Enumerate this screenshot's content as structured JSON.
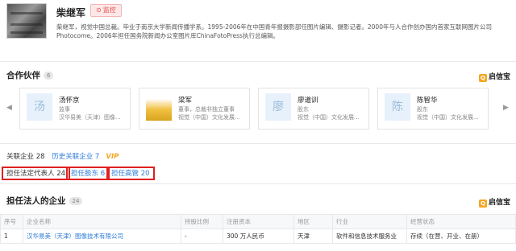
{
  "profile": {
    "name": "柴继军",
    "monitor_label": "监控",
    "bio": "柴继军，视觉中国总裁。毕业于南京大学新闻传播学系。1995-2006年在中国青年报摄影部任图片编辑、摄影记者。2000年与人合作创办国内首家互联网图片公司 Photocome。2006年担任国务院新闻办公室图片库ChinaFotoPress执行总编辑。"
  },
  "partners": {
    "title": "合作伙伴",
    "count": "6",
    "brand": "启信宝",
    "cards": [
      {
        "avatar": "汤",
        "name": "汤怀京",
        "role": "监事",
        "company": "汉华易美（天津）图像..."
      },
      {
        "avatar": "",
        "name": "梁军",
        "role": "董事，总裁非独立董事",
        "company": "视觉（中国）文化发展..."
      },
      {
        "avatar": "廖",
        "name": "廖道训",
        "role": "股东",
        "company": "视觉（中国）文化发展..."
      },
      {
        "avatar": "陈",
        "name": "陈智华",
        "role": "股东",
        "company": "视觉（中国）文化发展..."
      }
    ]
  },
  "tabs_primary": {
    "related": "关联企业 28",
    "history": "历史关联企业 7",
    "vip": "VIP"
  },
  "tabs_secondary": [
    "担任法定代表人 24",
    "担任股东 6",
    "担任高管 20"
  ],
  "legal_section": {
    "title": "担任法人的企业",
    "count": "24",
    "brand": "启信宝"
  },
  "table": {
    "headers": [
      "序号",
      "企业名称",
      "持股比例",
      "注册资本",
      "地区",
      "行业",
      "经营状态"
    ],
    "rows": [
      [
        "1",
        "汉华易美（天津）图像技术有限公司",
        "-",
        "300 万人民币",
        "天津",
        "软件和信息技术服务业",
        "存续（在营、开业、在册）"
      ]
    ]
  }
}
